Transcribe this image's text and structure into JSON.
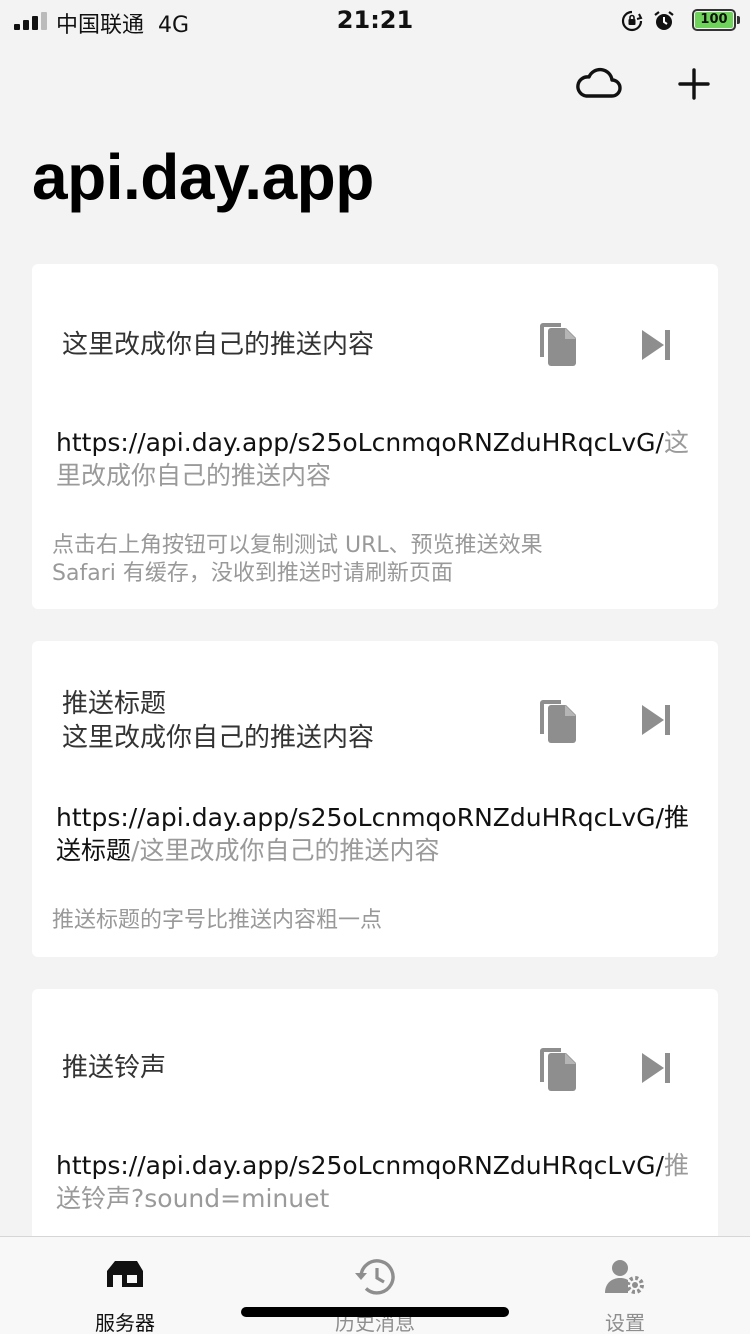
{
  "status_bar": {
    "carrier": "中国联通",
    "network": "4G",
    "time": "21:21",
    "battery": "100",
    "battery_color": "#6fd25a"
  },
  "nav": {
    "cloud_icon": "cloud-icon",
    "add_icon": "plus-icon"
  },
  "page_title": "api.day.app",
  "cards": [
    {
      "title": "这里改成你自己的推送内容",
      "url_base": "https://api.day.app/s25oLcnmqoRNZduHRqcLvG/",
      "url_bold": "",
      "url_rest": "这里改成你自己的推送内容",
      "hint_lines": [
        "点击右上角按钮可以复制测试 URL、预览推送效果",
        "Safari 有缓存，没收到推送时请刷新页面"
      ]
    },
    {
      "title_line1": "推送标题",
      "title_line2": "这里改成你自己的推送内容",
      "url_base": "https://api.day.app/s25oLcnmqoRNZduHRqcLvG/",
      "url_bold": "推送标题",
      "url_rest": "/这里改成你自己的推送内容",
      "hint_lines": [
        "推送标题的字号比推送内容粗一点"
      ]
    },
    {
      "title": "推送铃声",
      "url_base": "https://api.day.app/s25oLcnmqoRNZduHRqcLvG/",
      "url_bold": "",
      "url_rest": "推送铃声?sound=minuet"
    }
  ],
  "tabs": [
    {
      "label": "服务器",
      "icon": "server-icon",
      "active": true
    },
    {
      "label": "历史消息",
      "icon": "history-icon",
      "active": false
    },
    {
      "label": "设置",
      "icon": "settings-icon",
      "active": false
    }
  ],
  "colors": {
    "background": "#f3f3f3",
    "card": "#ffffff",
    "icon_gray": "#8e8e8e",
    "hint_gray": "#999999"
  }
}
